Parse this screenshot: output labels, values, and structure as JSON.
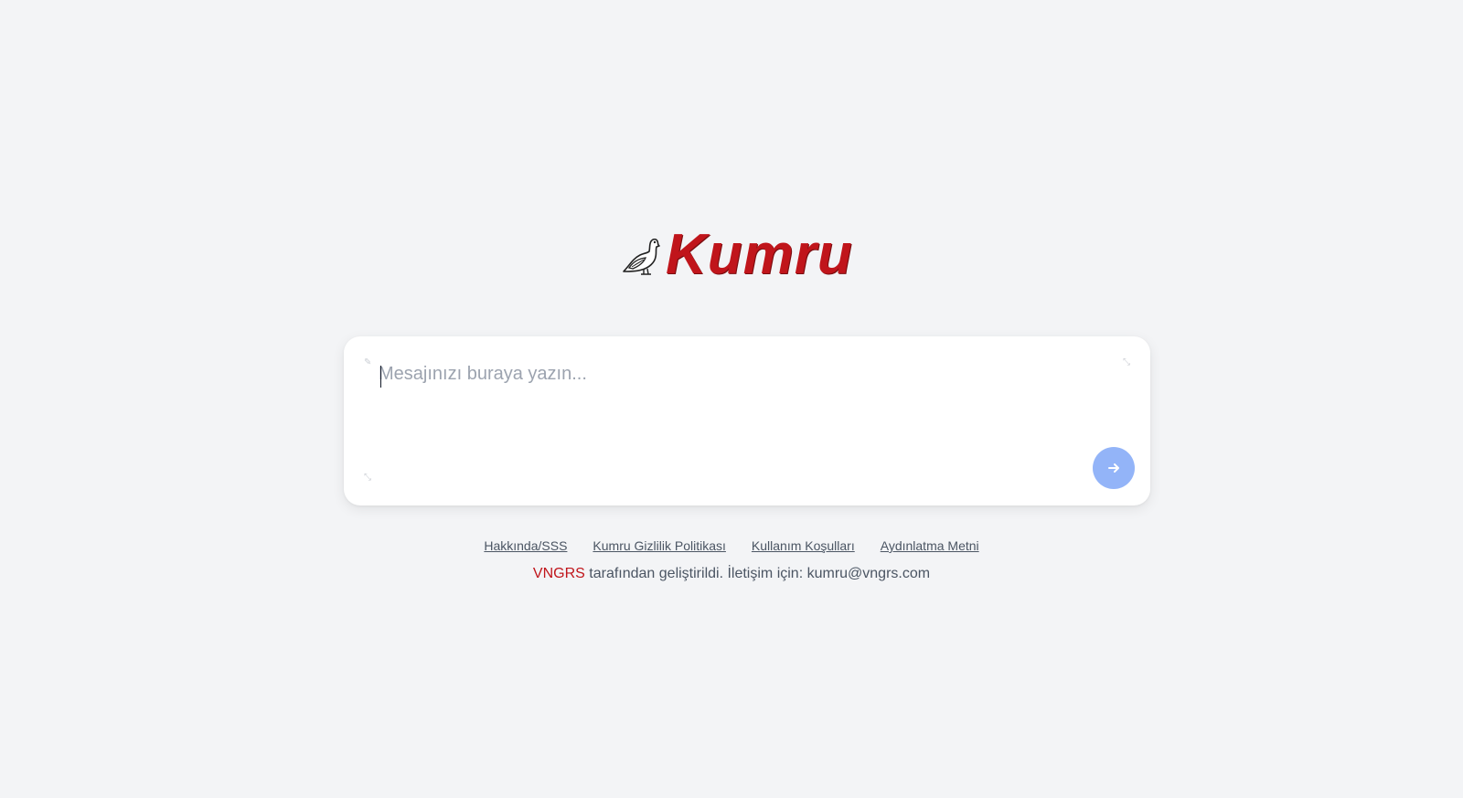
{
  "logo": {
    "text": "Kumru",
    "bird": "pigeon-icon"
  },
  "chat": {
    "placeholder": "Mesajınızı buraya yazın...",
    "value": "",
    "send_icon": "arrow-right-icon"
  },
  "footer": {
    "links": [
      {
        "label": "Hakkında/SSS"
      },
      {
        "label": "Kumru Gizlilik Politikası"
      },
      {
        "label": "Kullanım Koşulları"
      },
      {
        "label": "Aydınlatma Metni"
      }
    ],
    "credit_brand": "VNGRS",
    "credit_text": " tarafından geliştirildi. İletişim için: kumru@vngrs.com"
  },
  "colors": {
    "brand_red": "#c0151b",
    "send_button": "#93b4f8",
    "background": "#f3f4f6"
  }
}
